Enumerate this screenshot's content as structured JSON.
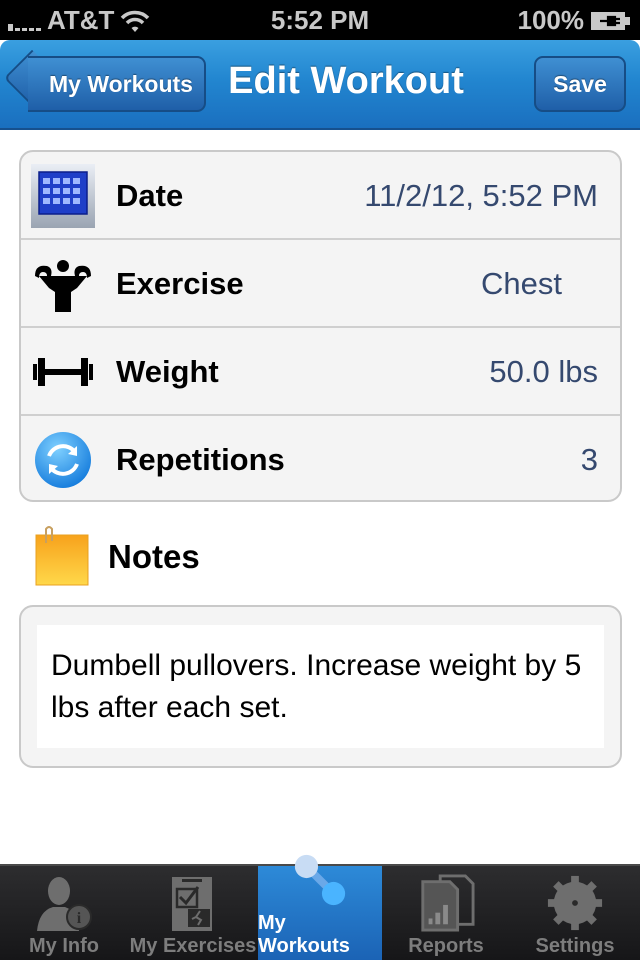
{
  "status_bar": {
    "carrier": "AT&T",
    "time": "5:52 PM",
    "battery": "100%"
  },
  "nav": {
    "back_label": "My Workouts",
    "title": "Edit Workout",
    "save_label": "Save"
  },
  "fields": [
    {
      "label": "Date",
      "value": "11/2/12, 5:52 PM",
      "icon": "calendar-icon"
    },
    {
      "label": "Exercise",
      "value": "Chest",
      "icon": "muscle-man-icon"
    },
    {
      "label": "Weight",
      "value": "50.0 lbs",
      "icon": "dumbbell-icon"
    },
    {
      "label": "Repetitions",
      "value": "3",
      "icon": "repeat-icon"
    }
  ],
  "notes": {
    "label": "Notes",
    "text": "Dumbell pullovers. Increase weight by 5 lbs after each set."
  },
  "tabs": [
    {
      "label": "My Info",
      "icon": "person-info-icon",
      "active": false
    },
    {
      "label": "My Exercises",
      "icon": "checklist-runner-icon",
      "active": false
    },
    {
      "label": "My Workouts",
      "icon": "workout-nodes-icon",
      "active": true
    },
    {
      "label": "Reports",
      "icon": "report-chart-icon",
      "active": false
    },
    {
      "label": "Settings",
      "icon": "gear-icon",
      "active": false
    }
  ],
  "colors": {
    "nav_blue": "#2286d0",
    "value_text": "#35496f",
    "tab_active": "#2378c8"
  }
}
